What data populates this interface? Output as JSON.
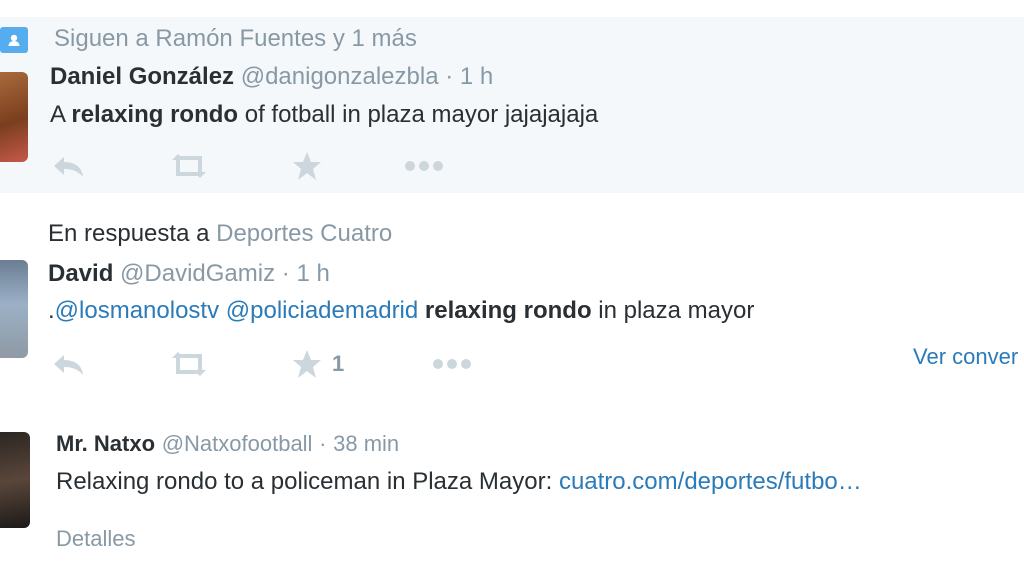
{
  "colors": {
    "link": "#2b7bb9",
    "muted": "#8899a6",
    "text": "#292f33",
    "highlight_bg": "#f5f8fa",
    "context_icon_bg": "#55acee"
  },
  "tweets": [
    {
      "context": "Siguen a Ramón Fuentes y 1 más",
      "context_icon": "person-icon",
      "name": "Daniel González",
      "handle": "@danigonzalezbla",
      "dot": "·",
      "time": "1 h",
      "text_parts": [
        "A ",
        "relaxing rondo",
        " of fotball in plaza mayor jajajajaja"
      ],
      "actions": {
        "reply_icon": "reply-icon",
        "retweet_icon": "retweet-icon",
        "favorite_icon": "star-icon",
        "more_icon": "more-icon"
      }
    },
    {
      "reply_prefix": "En respuesta a",
      "reply_to": "Deportes Cuatro",
      "name": "David",
      "handle": "@DavidGamiz",
      "dot": "·",
      "time": "1 h",
      "text_parts": [
        ".",
        "@losmanolostv",
        " ",
        "@policiademadrid",
        " ",
        "relaxing rondo",
        " in plaza mayor"
      ],
      "favorite_count": "1",
      "view_conversation": "Ver conver",
      "actions": {
        "reply_icon": "reply-icon",
        "retweet_icon": "retweet-icon",
        "favorite_icon": "star-icon",
        "more_icon": "more-icon"
      }
    },
    {
      "name": "Mr. Natxo",
      "handle": "@Natxofootball",
      "dot": "·",
      "time": "38 min",
      "text_parts": [
        "Relaxing rondo to a policeman in Plaza Mayor: ",
        "cuatro.com/deportes/futbo…"
      ],
      "details": "Detalles"
    }
  ]
}
